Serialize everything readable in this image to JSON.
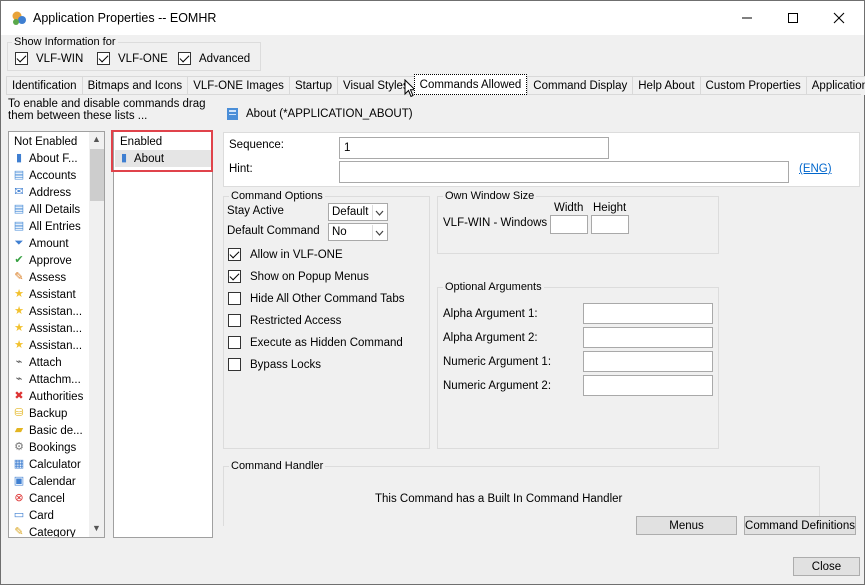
{
  "window": {
    "title": "Application Properties -- EOMHR"
  },
  "show_info": {
    "legend": "Show Information for",
    "options": [
      {
        "label": "VLF-WIN",
        "checked": true
      },
      {
        "label": "VLF-ONE",
        "checked": true
      },
      {
        "label": "Advanced",
        "checked": true
      }
    ]
  },
  "tabs": [
    "Identification",
    "Bitmaps and Icons",
    "VLF-ONE Images",
    "Startup",
    "Visual Styles",
    "Commands Allowed",
    "Command Display",
    "Help About",
    "Custom Properties",
    "Application Views"
  ],
  "active_tab": "Commands Allowed",
  "instructions": [
    "To enable and disable commands drag",
    "them between these lists ..."
  ],
  "not_enabled": {
    "header": "Not Enabled",
    "items": [
      {
        "label": "About F...",
        "icon": "book-icon"
      },
      {
        "label": "Accounts",
        "icon": "document-icon"
      },
      {
        "label": "Address",
        "icon": "envelope-icon"
      },
      {
        "label": "All Details",
        "icon": "document-icon"
      },
      {
        "label": "All Entries",
        "icon": "document-icon"
      },
      {
        "label": "Amount",
        "icon": "funnel-icon"
      },
      {
        "label": "Approve",
        "icon": "checkmark-icon"
      },
      {
        "label": "Assess",
        "icon": "pencil-icon"
      },
      {
        "label": "Assistant",
        "icon": "star-icon"
      },
      {
        "label": "Assistan...",
        "icon": "star-icon"
      },
      {
        "label": "Assistan...",
        "icon": "star-icon"
      },
      {
        "label": "Assistan...",
        "icon": "star-icon"
      },
      {
        "label": "Attach",
        "icon": "paperclip-icon"
      },
      {
        "label": "Attachm...",
        "icon": "paperclip-icon"
      },
      {
        "label": "Authorities",
        "icon": "x-icon"
      },
      {
        "label": "Backup",
        "icon": "database-icon"
      },
      {
        "label": "Basic de...",
        "icon": "folder-icon"
      },
      {
        "label": "Bookings",
        "icon": "gear-icon"
      },
      {
        "label": "Calculator",
        "icon": "calculator-icon"
      },
      {
        "label": "Calendar",
        "icon": "calendar-icon"
      },
      {
        "label": "Cancel",
        "icon": "cancel-icon"
      },
      {
        "label": "Card",
        "icon": "card-icon"
      },
      {
        "label": "Category",
        "icon": "category-icon"
      }
    ]
  },
  "enabled": {
    "header": "Enabled",
    "items": [
      {
        "label": "About",
        "icon": "book-icon"
      }
    ]
  },
  "command": {
    "heading": "About (*APPLICATION_ABOUT)",
    "sequence_label": "Sequence:",
    "sequence_value": "1",
    "hint_label": "Hint:",
    "hint_value": "",
    "lang_link": "(ENG)"
  },
  "command_options": {
    "legend": "Command Options",
    "stay_active_label": "Stay Active",
    "stay_active_value": "Default",
    "default_command_label": "Default Command",
    "default_command_value": "No",
    "checks": [
      {
        "label": "Allow in VLF-ONE",
        "checked": true
      },
      {
        "label": "Show on Popup Menus",
        "checked": true
      },
      {
        "label": "Hide All Other Command Tabs",
        "checked": false
      },
      {
        "label": "Restricted Access",
        "checked": false
      },
      {
        "label": "Execute as Hidden Command",
        "checked": false
      },
      {
        "label": "Bypass Locks",
        "checked": false
      }
    ]
  },
  "own_window": {
    "legend": "Own Window Size",
    "width_label": "Width",
    "height_label": "Height",
    "row_label": "VLF-WIN - Windows",
    "width_value": "",
    "height_value": ""
  },
  "optional_args": {
    "legend": "Optional Arguments",
    "args": [
      {
        "label": "Alpha Argument 1:",
        "value": ""
      },
      {
        "label": "Alpha Argument 2:",
        "value": ""
      },
      {
        "label": "Numeric Argument 1:",
        "value": ""
      },
      {
        "label": "Numeric Argument 2:",
        "value": ""
      }
    ]
  },
  "handler": {
    "legend": "Command Handler",
    "text": "This Command has a Built In Command Handler"
  },
  "buttons": {
    "menus": "Menus",
    "definitions": "Command Definitions",
    "close": "Close"
  },
  "colors": {
    "highlight_border": "#e0434b",
    "selection": "#e5e5e5",
    "link": "#0066cc"
  }
}
